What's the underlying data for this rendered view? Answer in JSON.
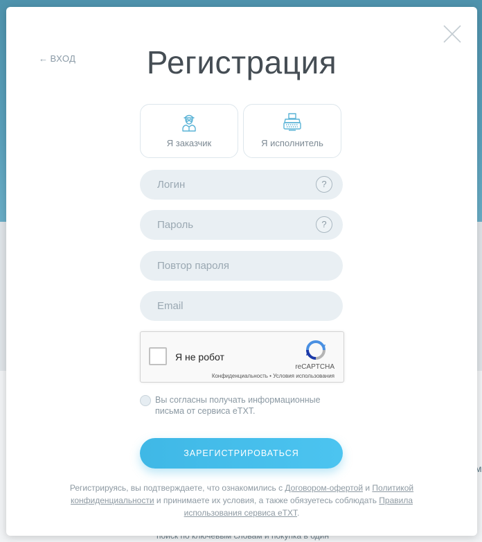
{
  "modal": {
    "title": "Регистрация",
    "back_link": "вход",
    "roles": [
      {
        "label": "Я заказчик",
        "icon": "customer-icon"
      },
      {
        "label": "Я исполнитель",
        "icon": "typewriter-icon"
      }
    ],
    "fields": {
      "login": {
        "placeholder": "Логин",
        "help": "?"
      },
      "password": {
        "placeholder": "Пароль",
        "help": "?"
      },
      "password_repeat": {
        "placeholder": "Повтор пароля"
      },
      "email": {
        "placeholder": "Email"
      }
    },
    "captcha": {
      "label": "Я не робот",
      "brand": "reCAPTCHA",
      "terms": "Конфиденциальность • Условия использования"
    },
    "consent": {
      "text": "Вы согласны получать информационные письма от сервиса eTXT."
    },
    "submit_label": "Зарегистрироваться",
    "legal": {
      "p1": "Регистрируясь, вы подтверждаете, что ознакомились с ",
      "link1": "Договором-офертой",
      "p2": " и ",
      "link2": "Политикой конфиденциальности",
      "p3": " и принимаете их условия, а также обязуетесь соблюдать ",
      "link3": "Правила использования сервиса eTXT",
      "p4": "."
    }
  },
  "background": {
    "bottom_text": "поиск по ключевым словам и покупка в один",
    "right_edge_text": "м"
  },
  "colors": {
    "accent": "#4cc4f0",
    "field_bg": "#e9eff3",
    "title": "#454d54",
    "icon": "#5ab3d6"
  }
}
